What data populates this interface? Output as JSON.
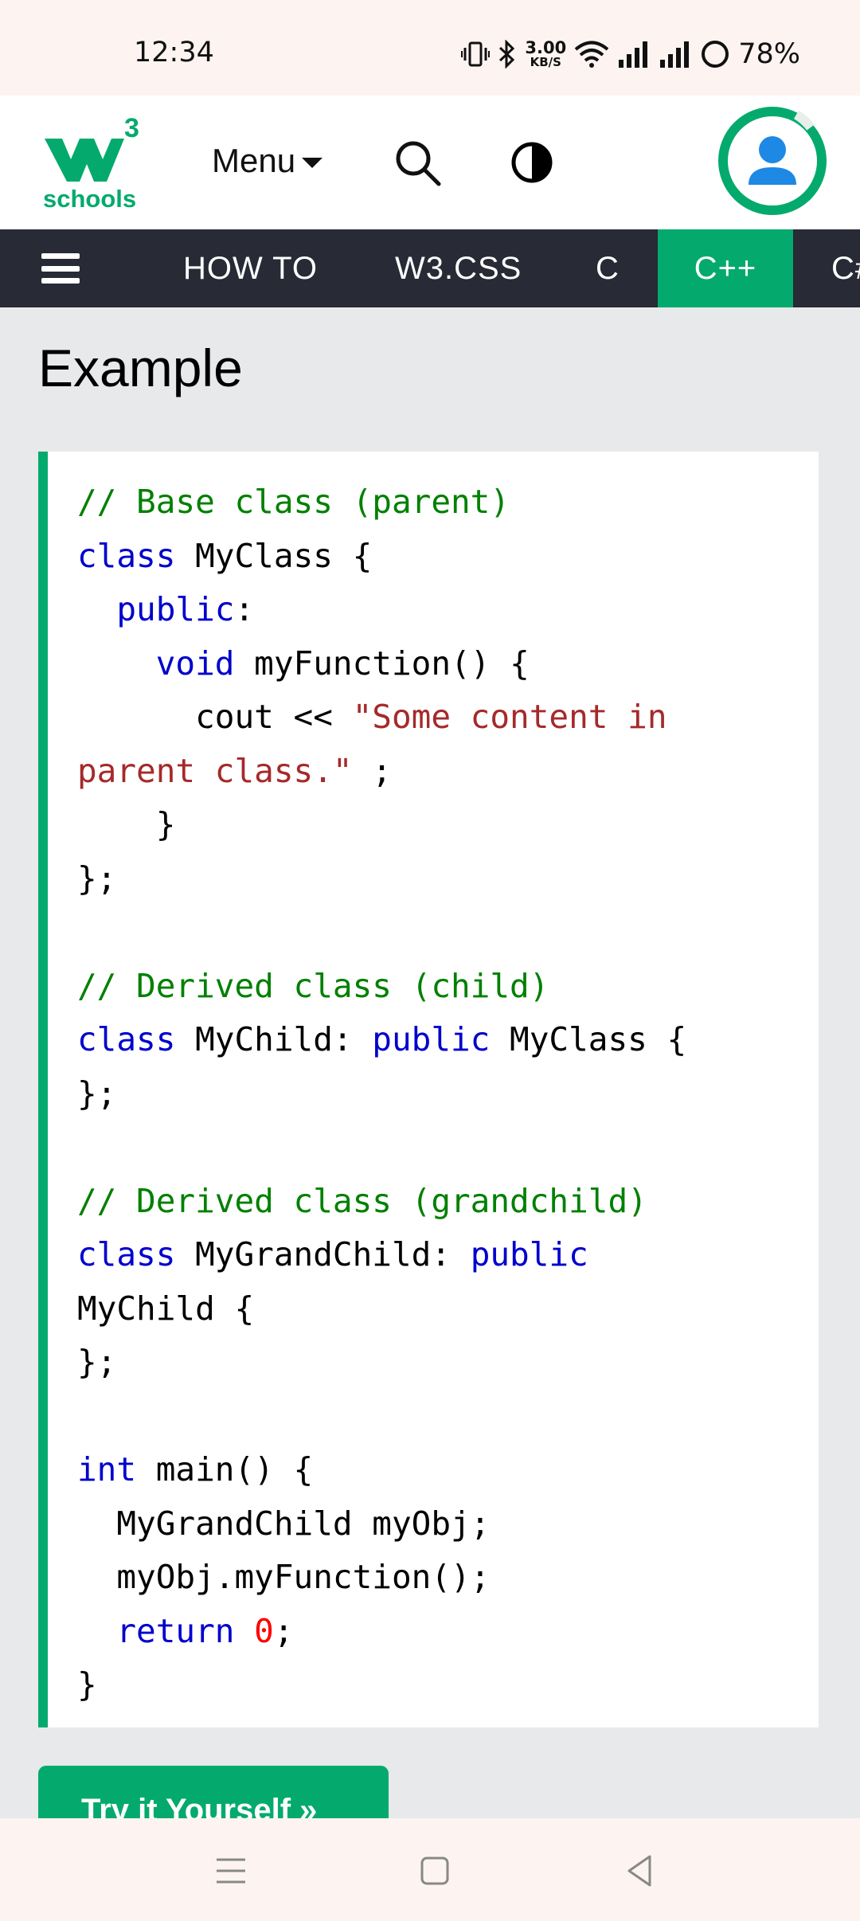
{
  "status": {
    "time": "12:34",
    "speed_value": "3.00",
    "speed_unit": "KB/S",
    "battery": "78%"
  },
  "header": {
    "logo_text": "schools",
    "logo_superscript": "3",
    "menu_label": "Menu"
  },
  "nav": {
    "items": [
      "HOW TO",
      "W3.CSS",
      "C",
      "C++",
      "C#"
    ],
    "active": "C++"
  },
  "main": {
    "title": "Example",
    "code_lines": [
      [
        {
          "t": "// Base class (parent)",
          "c": "comment"
        }
      ],
      [
        {
          "t": "class",
          "c": "kw"
        },
        {
          "t": " MyClass {",
          "c": ""
        }
      ],
      [
        {
          "t": "  ",
          "c": ""
        },
        {
          "t": "public",
          "c": "kw"
        },
        {
          "t": ":",
          "c": ""
        }
      ],
      [
        {
          "t": "    ",
          "c": ""
        },
        {
          "t": "void",
          "c": "kw"
        },
        {
          "t": " myFunction() {",
          "c": ""
        }
      ],
      [
        {
          "t": "      cout << ",
          "c": ""
        },
        {
          "t": "\"Some content in",
          "c": "str"
        }
      ],
      [
        {
          "t": "parent class.\"",
          "c": "str"
        },
        {
          "t": " ;",
          "c": ""
        }
      ],
      [
        {
          "t": "    }",
          "c": ""
        }
      ],
      [
        {
          "t": "};",
          "c": ""
        }
      ],
      [
        {
          "t": "",
          "c": ""
        }
      ],
      [
        {
          "t": "// Derived class (child)",
          "c": "comment"
        }
      ],
      [
        {
          "t": "class",
          "c": "kw"
        },
        {
          "t": " MyChild: ",
          "c": ""
        },
        {
          "t": "public",
          "c": "kw"
        },
        {
          "t": " MyClass {",
          "c": ""
        }
      ],
      [
        {
          "t": "};",
          "c": ""
        }
      ],
      [
        {
          "t": "",
          "c": ""
        }
      ],
      [
        {
          "t": "// Derived class (grandchild)",
          "c": "comment"
        }
      ],
      [
        {
          "t": "class",
          "c": "kw"
        },
        {
          "t": " MyGrandChild: ",
          "c": ""
        },
        {
          "t": "public",
          "c": "kw"
        }
      ],
      [
        {
          "t": "MyChild {",
          "c": ""
        }
      ],
      [
        {
          "t": "};",
          "c": ""
        }
      ],
      [
        {
          "t": "",
          "c": ""
        }
      ],
      [
        {
          "t": "int",
          "c": "kw"
        },
        {
          "t": " main() {",
          "c": ""
        }
      ],
      [
        {
          "t": "  MyGrandChild myObj;",
          "c": ""
        }
      ],
      [
        {
          "t": "  myObj.myFunction();",
          "c": ""
        }
      ],
      [
        {
          "t": "  ",
          "c": ""
        },
        {
          "t": "return",
          "c": "kw"
        },
        {
          "t": " ",
          "c": ""
        },
        {
          "t": "0",
          "c": "num"
        },
        {
          "t": ";",
          "c": ""
        }
      ],
      [
        {
          "t": "}",
          "c": ""
        }
      ]
    ],
    "try_button": "Try it Yourself »"
  },
  "colors": {
    "brand_green": "#04aa6d",
    "nav_dark": "#282a35",
    "page_bg": "#e7e9eb",
    "comment": "#008000",
    "keyword": "#0000cd",
    "string": "#a52a2a",
    "number": "#ff0000"
  },
  "icons": {
    "status": [
      "vibrate-icon",
      "bluetooth-icon",
      "wifi-icon",
      "signal-icon",
      "signal-icon",
      "battery-ring-icon"
    ],
    "header": [
      "w3schools-logo",
      "search-icon",
      "contrast-icon",
      "user-avatar-icon"
    ],
    "system_nav": [
      "recents-icon",
      "home-icon",
      "back-icon"
    ]
  }
}
